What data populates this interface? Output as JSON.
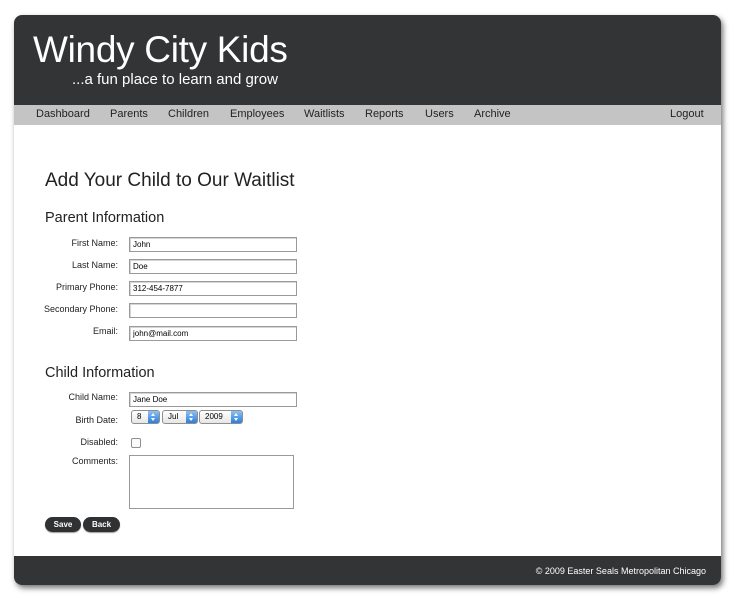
{
  "header": {
    "title": "Windy City Kids",
    "tagline": "...a fun place to learn and grow"
  },
  "nav": {
    "items": [
      "Dashboard",
      "Parents",
      "Children",
      "Employees",
      "Waitlists",
      "Reports",
      "Users",
      "Archive"
    ],
    "logout": "Logout"
  },
  "page": {
    "title": "Add Your Child to Our Waitlist"
  },
  "parent": {
    "section_title": "Parent Information",
    "first_name_label": "First Name:",
    "first_name": "John",
    "last_name_label": "Last Name:",
    "last_name": "Doe",
    "primary_phone_label": "Primary Phone:",
    "primary_phone": "312-454-7877",
    "secondary_phone_label": "Secondary Phone:",
    "secondary_phone": "",
    "email_label": "Email:",
    "email": "john@mail.com"
  },
  "child": {
    "section_title": "Child Information",
    "name_label": "Child Name:",
    "name": "Jane Doe",
    "birth_date_label": "Birth Date:",
    "birth_day": "8",
    "birth_month": "Jul",
    "birth_year": "2009",
    "disabled_label": "Disabled:",
    "disabled": false,
    "comments_label": "Comments:",
    "comments": ""
  },
  "buttons": {
    "save": "Save",
    "back": "Back"
  },
  "footer": {
    "text": "© 2009 Easter Seals Metropolitan Chicago"
  },
  "colors": {
    "header_bg": "#323436",
    "nav_bg": "#c4c4c4",
    "select_arrow_accent": "#2d7ed8"
  }
}
